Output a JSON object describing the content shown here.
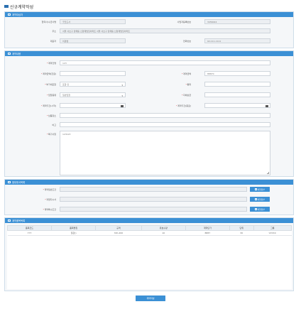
{
  "page": {
    "title": "신규계약작성"
  },
  "colors": {
    "accent": "#3b90d5",
    "required": "#d33333"
  },
  "party": {
    "header": "계약대상자",
    "company_label": "협력사/수급사명",
    "company_value": "굿코드사",
    "bizno_label": "사업자등록번호",
    "bizno_value": "3456024",
    "addr_label": "주소",
    "addr_value": "서울 서초구 양재동 신양재빌딩아파트 서울 서초구 양재동 신양재빌딩아파트",
    "ceo_label": "대표자",
    "ceo_value": "이경섭",
    "phone_label": "전화번호",
    "phone_value": "02-111-1111"
  },
  "contract": {
    "header": "계약내용",
    "name_label": "계약건명",
    "name_value": "123",
    "amount_kr_label": "계약금액(한글)",
    "amount_label": "계약금액",
    "amount_value": "88870",
    "vat_label": "부가세포함",
    "vat_value": "포함 안",
    "currency_label": "통화",
    "type_label": "입찰종류",
    "type_value": "일반입찰",
    "method_label": "지체상금",
    "start_label": "계약기간(시작)",
    "end_label": "계약기간(종료)",
    "place_label": "납품장소",
    "note_label": "비고",
    "special_label": "특기사항",
    "special_value": "123123"
  },
  "attachments": {
    "header": "첨부문서목록",
    "rows": [
      {
        "label": "계약일반조건",
        "button": "파일첨부"
      },
      {
        "label": "과업지시서",
        "button": "파일첨부"
      },
      {
        "label": "계약특수조건",
        "button": "파일첨부"
      }
    ]
  },
  "items": {
    "header": "계약품목목록",
    "columns": [
      "품목코드",
      "품목명칭",
      "규격",
      "유효수량",
      "계약단가",
      "단위",
      "그룹"
    ],
    "rows": [
      [
        "777",
        "일관()",
        "hhh-200",
        "10",
        "8887",
        "30",
        "VVVCC"
      ]
    ]
  },
  "submit": {
    "label": "계약작성"
  }
}
